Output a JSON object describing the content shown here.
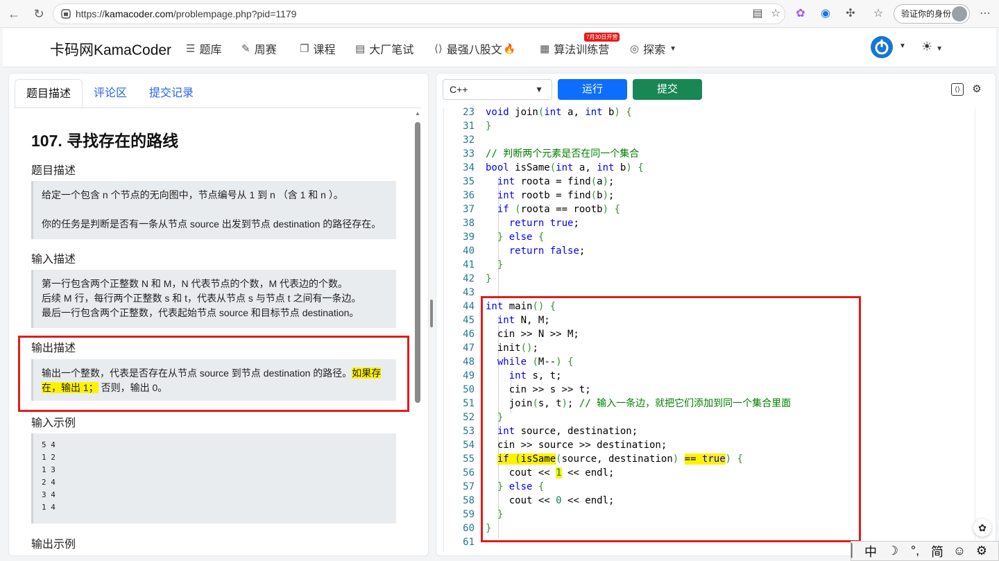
{
  "browser": {
    "url_prefix": "https://",
    "url_host": "kamacoder.com",
    "url_path": "/problempage.php?pid=1179",
    "verify_label": "验证你的身份"
  },
  "header": {
    "logo": "卡码网KamaCoder",
    "nav": [
      {
        "label": "题库",
        "icon": "list-icon"
      },
      {
        "label": "周赛",
        "icon": "pencil-icon"
      },
      {
        "label": "课程",
        "icon": "copy-icon"
      },
      {
        "label": "大厂笔试",
        "icon": "document-icon"
      },
      {
        "label": "最强八股文",
        "icon": "code-file-icon"
      },
      {
        "label": "算法训练营",
        "icon": "calendar-icon"
      },
      {
        "label": "探索",
        "icon": "compass-icon"
      }
    ],
    "badge": "7月30日开营",
    "fire": "🔥"
  },
  "left": {
    "tabs": [
      "题目描述",
      "评论区",
      "提交记录"
    ],
    "title": "107. 寻找存在的路线",
    "sections": {
      "desc_label": "题目描述",
      "desc_p1": "给定一个包含 n 个节点的无向图中，节点编号从 1 到 n （含 1 和 n ）。",
      "desc_p2": "你的任务是判断是否有一条从节点 source 出发到节点 destination 的路径存在。",
      "input_label": "输入描述",
      "input_l1": "第一行包含两个正整数 N 和 M，N 代表节点的个数，M 代表边的个数。",
      "input_l2": "后续 M 行，每行两个正整数 s 和 t，代表从节点 s 与节点 t 之间有一条边。",
      "input_l3": "最后一行包含两个正整数，代表起始节点 source 和目标节点 destination。",
      "output_label": "输出描述",
      "output_a": "输出一个整数，代表是否存在从节点 source 到节点 destination 的路径。",
      "output_hl1": "如果存",
      "output_hl2": "在，输出 1；",
      "output_b": "否则，输出 0。",
      "sample_in_label": "输入示例",
      "sample_in": [
        "5 4",
        "1 2",
        "1 3",
        "2 4",
        "3 4",
        "1 4"
      ],
      "sample_out_label": "输出示例"
    }
  },
  "editor": {
    "language": "C++",
    "run_label": "运行",
    "submit_label": "提交"
  },
  "ime": [
    "中",
    "☽",
    "°,",
    "简",
    "☺",
    "⚙"
  ]
}
